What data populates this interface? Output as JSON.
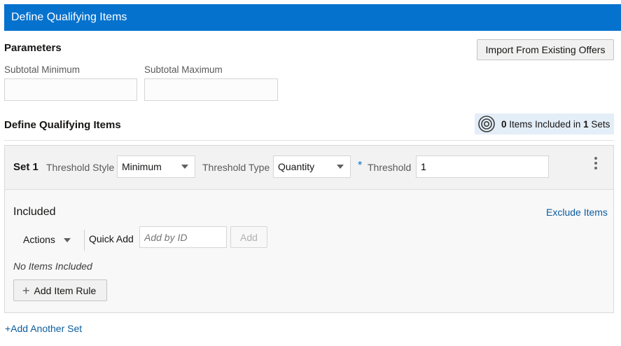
{
  "header": {
    "title": "Define Qualifying Items"
  },
  "parameters": {
    "heading": "Parameters",
    "import_button": "Import From Existing Offers",
    "subtotal_min_label": "Subtotal Minimum",
    "subtotal_max_label": "Subtotal Maximum",
    "subtotal_min_value": "",
    "subtotal_max_value": ""
  },
  "qualifying": {
    "heading": "Define Qualifying Items",
    "summary": {
      "items_count": "0",
      "items_text": "Items Included in",
      "sets_count": "1",
      "sets_text": "Sets"
    }
  },
  "set": {
    "title": "Set 1",
    "threshold_style_label": "Threshold Style",
    "threshold_style_value": "Minimum",
    "threshold_type_label": "Threshold Type",
    "threshold_type_value": "Quantity",
    "required_marker": "*",
    "threshold_label": "Threshold",
    "threshold_value": "1",
    "included_label": "Included",
    "exclude_link": "Exclude Items",
    "actions_label": "Actions",
    "quick_add_label": "Quick Add",
    "quick_add_placeholder": "Add by ID",
    "add_button": "Add",
    "no_items_text": "No Items Included",
    "add_item_rule_button": "Add Item Rule",
    "add_item_rule_icon": "+"
  },
  "add_another_set": "+Add Another Set",
  "colors": {
    "header_bg": "#0572ce",
    "link": "#0b5c9e",
    "summary_bg": "#e4eef8"
  },
  "icons": [
    "target-icon",
    "chevron-down-icon",
    "kebab-menu-icon",
    "plus-icon"
  ]
}
